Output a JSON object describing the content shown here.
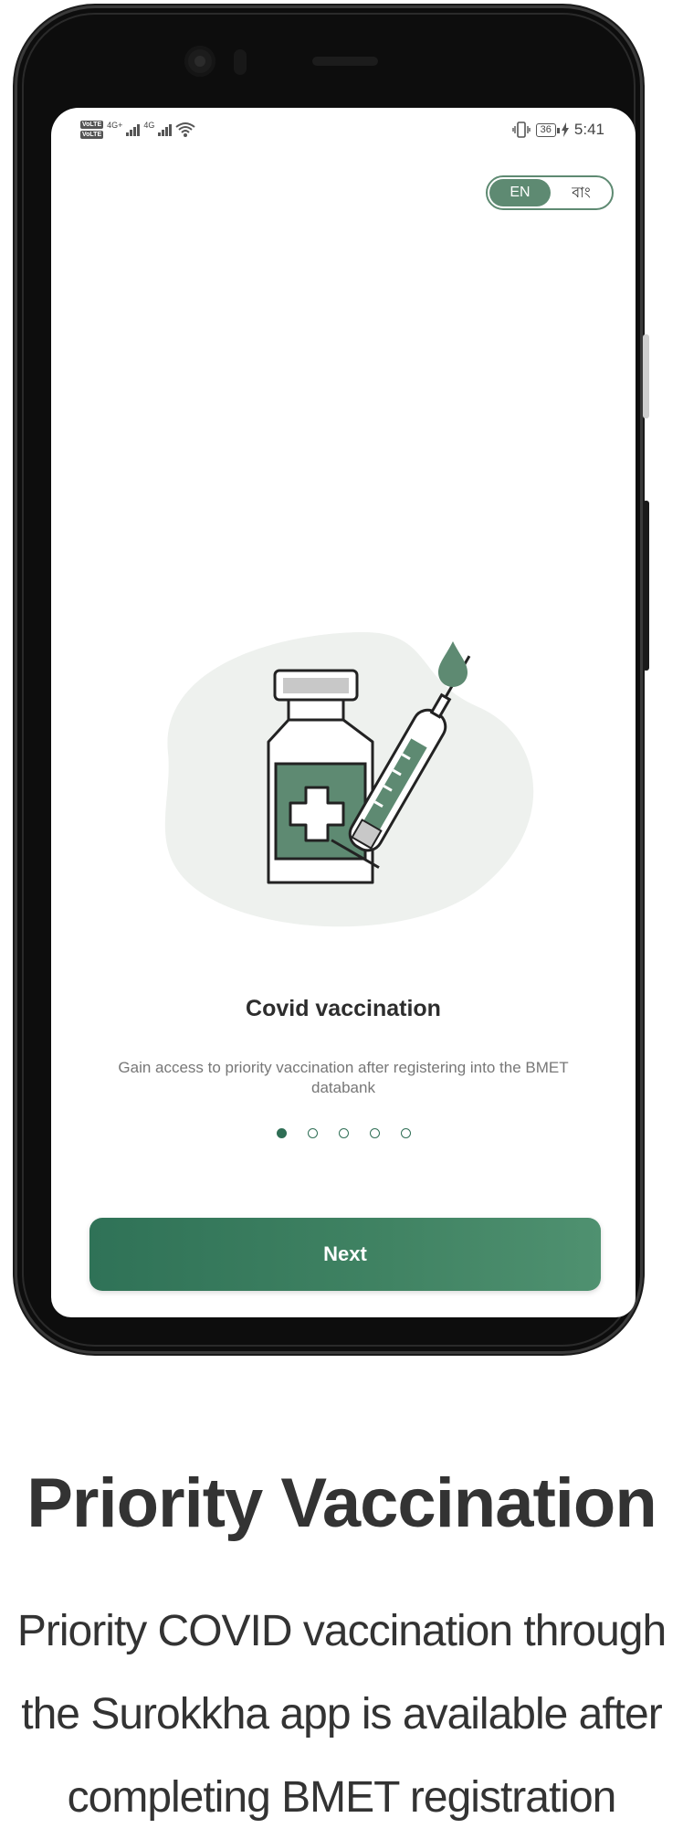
{
  "status_bar": {
    "volte_tags": [
      "VoLTE",
      "VoLTE"
    ],
    "network_labels": [
      "4G+",
      "4G"
    ],
    "battery": "36",
    "time": "5:41",
    "icons": [
      "signal-icon",
      "wifi-icon",
      "vibrate-icon",
      "charging-icon"
    ]
  },
  "language_toggle": {
    "options": [
      "EN",
      "বাং"
    ],
    "selected": "EN",
    "accent_color": "#5e8a72"
  },
  "onboarding": {
    "illustration": "vaccine-bottle-and-syringe-illustration",
    "title": "Covid vaccination",
    "description": "Gain access to priority vaccination after registering into the BMET databank",
    "page_count": 5,
    "current_page": 1,
    "next_label": "Next",
    "button_colors": [
      "#2f7257",
      "#4f9170"
    ]
  },
  "caption": {
    "title": "Priority Vaccination",
    "body_lines": [
      "Priority COVID vaccination through",
      "the Surokkha app is available after",
      "completing BMET registration"
    ]
  }
}
